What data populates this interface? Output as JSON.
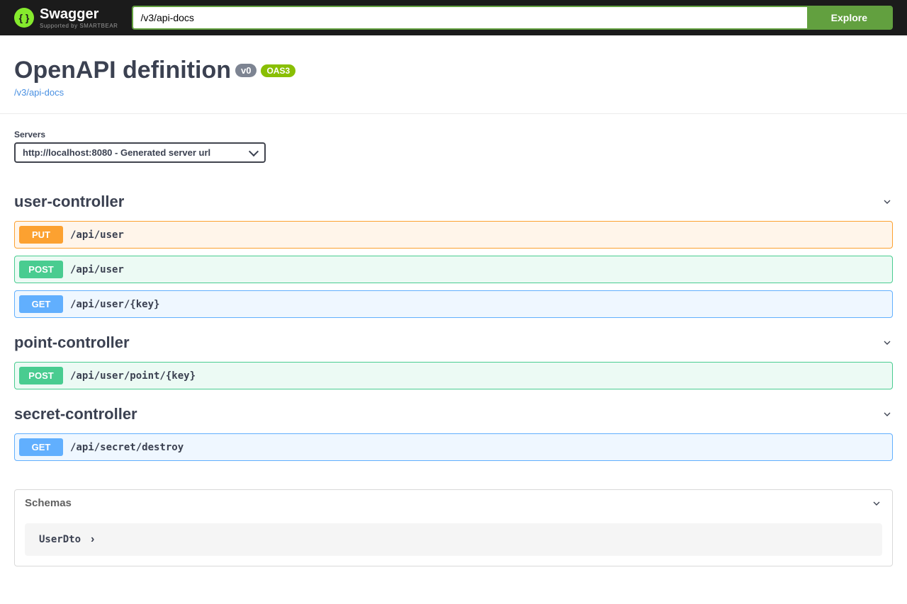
{
  "header": {
    "logo_main": "Swagger",
    "logo_sub": "Supported by SMARTBEAR",
    "search_value": "/v3/api-docs",
    "explore_label": "Explore"
  },
  "info": {
    "title": "OpenAPI definition",
    "version_badge": "v0",
    "oas_badge": "OAS3",
    "docs_link": "/v3/api-docs"
  },
  "servers": {
    "label": "Servers",
    "selected": "http://localhost:8080 - Generated server url"
  },
  "tags": [
    {
      "name": "user-controller",
      "ops": [
        {
          "method": "PUT",
          "path": "/api/user",
          "cls": "put"
        },
        {
          "method": "POST",
          "path": "/api/user",
          "cls": "post"
        },
        {
          "method": "GET",
          "path": "/api/user/{key}",
          "cls": "get"
        }
      ]
    },
    {
      "name": "point-controller",
      "ops": [
        {
          "method": "POST",
          "path": "/api/user/point/{key}",
          "cls": "post"
        }
      ]
    },
    {
      "name": "secret-controller",
      "ops": [
        {
          "method": "GET",
          "path": "/api/secret/destroy",
          "cls": "get"
        }
      ]
    }
  ],
  "schemas": {
    "title": "Schemas",
    "items": [
      "UserDto"
    ]
  }
}
